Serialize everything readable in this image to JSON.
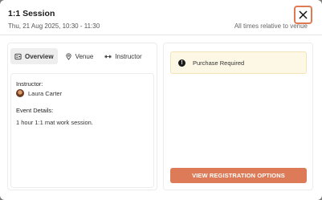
{
  "header": {
    "title": "1:1 Session",
    "datetime": "Thu, 21 Aug 2025, 10:30 - 11:30",
    "timezone_note": "All times relative to venue"
  },
  "tabs": [
    {
      "label": "Overview",
      "icon": "overview-icon",
      "active": true
    },
    {
      "label": "Venue",
      "icon": "location-pin-icon",
      "active": false
    },
    {
      "label": "Instructor",
      "icon": "instructor-icon",
      "active": false
    }
  ],
  "overview": {
    "instructor_label": "Instructor:",
    "instructor_name": "Laura Carter",
    "event_details_label": "Event Details:",
    "event_details": "1 hour 1:1 mat work session."
  },
  "purchase": {
    "alert_text": "Purchase Required",
    "alert_icon": "exclamation-icon",
    "cta_label": "VIEW REGISTRATION OPTIONS"
  },
  "colors": {
    "accent": "#dd7a57",
    "alert_bg": "#fdf8e6",
    "overlay": "#7d7d7d"
  }
}
